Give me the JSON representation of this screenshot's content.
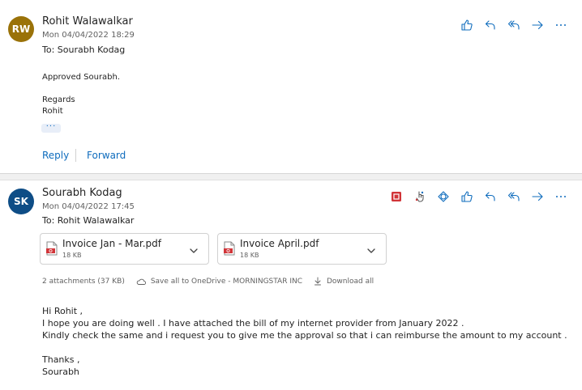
{
  "colors": {
    "accent": "#0f6cbd",
    "rw_avatar": "#9a7209",
    "sk_avatar": "#0e4d86",
    "pdf_red": "#d13438"
  },
  "message1": {
    "avatar_initials": "RW",
    "sender": "Rohit Walawalkar",
    "date": "Mon 04/04/2022 18:29",
    "to": "To: Sourabh Kodag",
    "body": [
      "Approved Sourabh.",
      "",
      "Regards",
      "Rohit"
    ],
    "expand_label": "···",
    "reply_label": "Reply",
    "forward_label": "Forward",
    "actions": [
      "like-icon",
      "reply-icon",
      "reply-all-icon",
      "forward-icon",
      "more-icon"
    ]
  },
  "message2": {
    "avatar_initials": "SK",
    "sender": "Sourabh Kodag",
    "date": "Mon 04/04/2022 17:45",
    "to": "To: Rohit Walawalkar",
    "actions": [
      "red-app-icon",
      "finger-pointer-icon",
      "loop-icon",
      "like-icon",
      "reply-icon",
      "reply-all-icon",
      "forward-icon",
      "more-icon"
    ],
    "attachments": [
      {
        "name": "Invoice Jan - Mar.pdf",
        "size": "18 KB"
      },
      {
        "name": "Invoice April.pdf",
        "size": "18 KB"
      }
    ],
    "attachment_summary": "2 attachments (37 KB)",
    "save_all_label": "Save all to OneDrive - MORNINGSTAR INC",
    "download_all_label": "Download all",
    "body": [
      "Hi Rohit ,",
      "I hope you are doing well . I have attached the bill of my internet provider from January 2022 .",
      "Kindly check the same and i request you to give me the approval so that i can reimburse the amount to my account .",
      "",
      "Thanks ,",
      "Sourabh"
    ]
  }
}
